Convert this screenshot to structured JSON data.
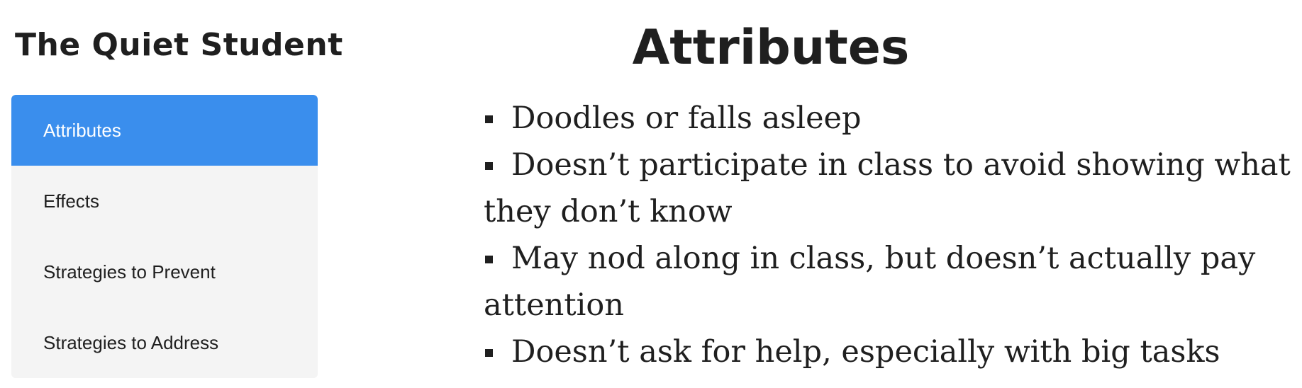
{
  "sidebar": {
    "title": "The Quiet Student",
    "items": [
      {
        "label": "Attributes",
        "active": true
      },
      {
        "label": "Effects",
        "active": false
      },
      {
        "label": "Strategies to Prevent",
        "active": false
      },
      {
        "label": "Strategies to Address",
        "active": false
      }
    ]
  },
  "main": {
    "heading": "Attributes",
    "items": [
      "Doodles or falls asleep",
      "Doesn’t participate in class to avoid showing what they don’t know",
      "May nod along in class, but doesn’t actually pay attention",
      "Doesn’t ask for help, especially with big tasks"
    ]
  },
  "colors": {
    "accent": "#3a8eed",
    "nav_background": "#f4f4f4",
    "text": "#1f1f1f"
  }
}
